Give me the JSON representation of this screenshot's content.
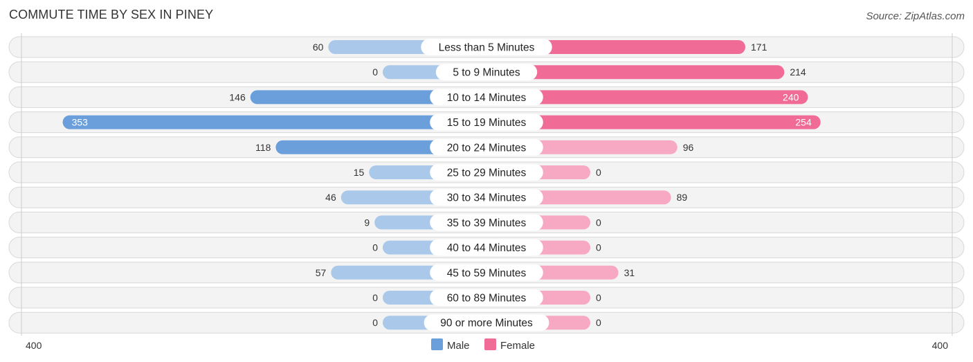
{
  "title": "COMMUTE TIME BY SEX IN PINEY",
  "source": "Source: ZipAtlas.com",
  "colors": {
    "male_strong": "#6a9fdc",
    "male_light": "#a9c8ea",
    "female_strong": "#f06b96",
    "female_light": "#f7a8c3",
    "row_bg": "#f3f3f3"
  },
  "chart_data": {
    "type": "bar",
    "orientation": "horizontal-diverging",
    "title": "COMMUTE TIME BY SEX IN PINEY",
    "categories": [
      "Less than 5 Minutes",
      "5 to 9 Minutes",
      "10 to 14 Minutes",
      "15 to 19 Minutes",
      "20 to 24 Minutes",
      "25 to 29 Minutes",
      "30 to 34 Minutes",
      "35 to 39 Minutes",
      "40 to 44 Minutes",
      "45 to 59 Minutes",
      "60 to 89 Minutes",
      "90 or more Minutes"
    ],
    "series": [
      {
        "name": "Male",
        "values": [
          60,
          0,
          146,
          353,
          118,
          15,
          46,
          9,
          0,
          57,
          0,
          0
        ]
      },
      {
        "name": "Female",
        "values": [
          171,
          214,
          240,
          254,
          96,
          0,
          89,
          0,
          0,
          31,
          0,
          0
        ]
      }
    ],
    "axis": {
      "left_label": "400",
      "right_label": "400",
      "range": [
        0,
        400
      ]
    },
    "legend": {
      "position": "bottom-center",
      "items": [
        "Male",
        "Female"
      ]
    },
    "grid": false
  }
}
